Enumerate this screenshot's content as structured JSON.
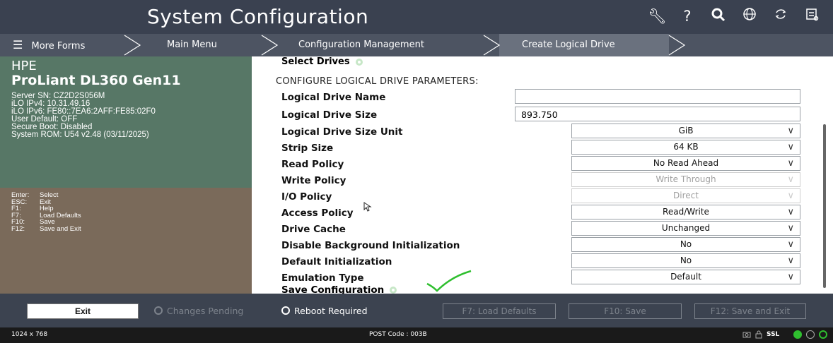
{
  "header": {
    "title": "System Configuration",
    "icons": [
      "wrench-icon",
      "help-icon",
      "search-icon",
      "globe-icon",
      "refresh-icon",
      "log-icon"
    ]
  },
  "breadcrumb": {
    "menu_label": "More Forms",
    "items": [
      "Main Menu",
      "Configuration Management",
      "Create Logical Drive"
    ]
  },
  "server_info": {
    "brand": "HPE",
    "model": "ProLiant DL360 Gen11",
    "lines": [
      "Server SN: CZ2D2S056M",
      "iLO IPv4: 10.31.49.16",
      "iLO IPv6: FE80::7EA6:2AFF:FE85:02F0",
      "User Default: OFF",
      "Secure Boot: Disabled",
      "System ROM: U54 v2.48 (03/11/2025)"
    ]
  },
  "key_help": [
    {
      "key": "Enter:",
      "action": "Select"
    },
    {
      "key": "ESC:",
      "action": "Exit"
    },
    {
      "key": "F1:",
      "action": "Help"
    },
    {
      "key": "F7:",
      "action": "Load Defaults"
    },
    {
      "key": "F10:",
      "action": "Save"
    },
    {
      "key": "F12:",
      "action": "Save and Exit"
    }
  ],
  "form": {
    "select_drives": "Select Drives",
    "section_title": "CONFIGURE LOGICAL DRIVE PARAMETERS:",
    "logical_drive_name": {
      "label": "Logical Drive Name",
      "value": ""
    },
    "logical_drive_size": {
      "label": "Logical Drive Size",
      "value": "893.750"
    },
    "selects": [
      {
        "label": "Logical Drive Size Unit",
        "value": "GiB",
        "disabled": false
      },
      {
        "label": "Strip Size",
        "value": "64 KB",
        "disabled": false
      },
      {
        "label": "Read Policy",
        "value": "No Read Ahead",
        "disabled": false
      },
      {
        "label": "Write Policy",
        "value": "Write Through",
        "disabled": true
      },
      {
        "label": "I/O Policy",
        "value": "Direct",
        "disabled": true
      },
      {
        "label": "Access Policy",
        "value": "Read/Write",
        "disabled": false
      },
      {
        "label": "Drive Cache",
        "value": "Unchanged",
        "disabled": false
      },
      {
        "label": "Disable Background Initialization",
        "value": "No",
        "disabled": false
      },
      {
        "label": "Default Initialization",
        "value": "No",
        "disabled": false
      },
      {
        "label": "Emulation Type",
        "value": "Default",
        "disabled": false
      }
    ],
    "save_configuration": "Save Configuration"
  },
  "footer": {
    "exit_label": "Exit",
    "changes_pending": "Changes Pending",
    "reboot_required": "Reboot Required",
    "load_defaults": "F7: Load Defaults",
    "save": "F10: Save",
    "save_exit": "F12: Save and Exit"
  },
  "statusbar": {
    "resolution": "1024 x 768",
    "post_code": "POST Code : 003B",
    "ssl": "SSL"
  },
  "colors": {
    "header_bg": "#3a4150",
    "info_panel": "#577766",
    "keys_panel": "#7a6a5a",
    "accent_green": "#2fbf2f"
  }
}
